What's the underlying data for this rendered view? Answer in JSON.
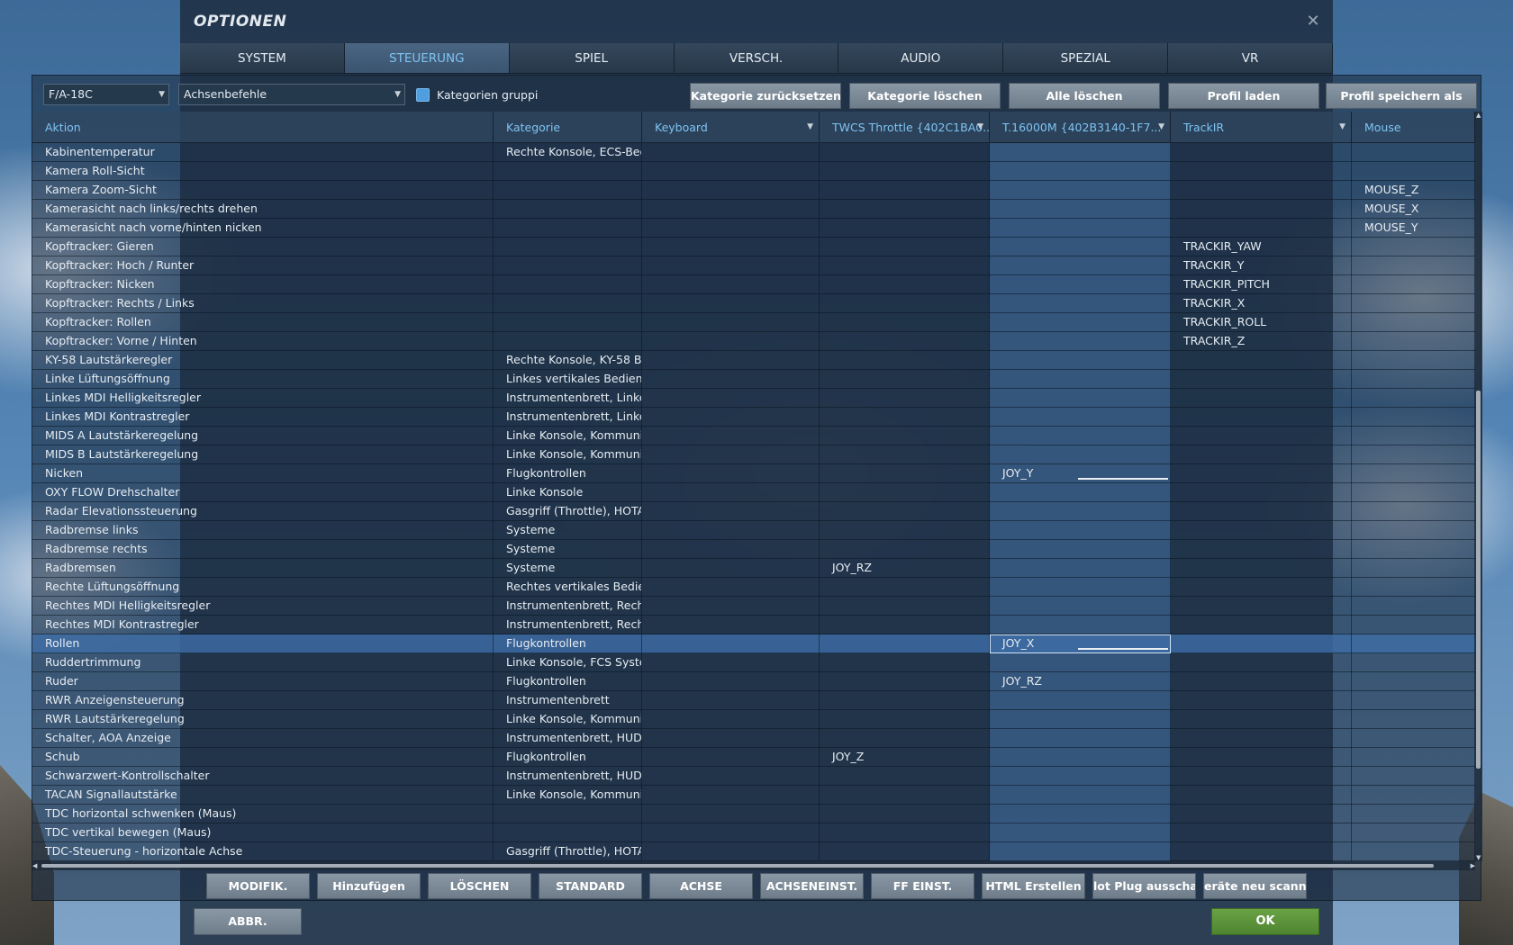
{
  "dialog": {
    "title": "OPTIONEN",
    "close_symbol": "✕"
  },
  "tabs": [
    {
      "label": "SYSTEM"
    },
    {
      "label": "STEUERUNG",
      "active": true
    },
    {
      "label": "SPIEL"
    },
    {
      "label": "VERSCH."
    },
    {
      "label": "AUDIO"
    },
    {
      "label": "SPEZIAL"
    },
    {
      "label": "VR"
    }
  ],
  "toolbar": {
    "aircraft_select": "F/A-18C",
    "category_select": "Achsenbefehle",
    "group_checkbox_label": "Kategorien gruppi",
    "group_checkbox_checked": true,
    "buttons": [
      "Kategorie zurücksetzen",
      "Kategorie löschen",
      "Alle löschen",
      "Profil laden",
      "Profil speichern als"
    ]
  },
  "columns": [
    "Aktion",
    "Kategorie",
    "Keyboard",
    "TWCS Throttle {402C1BA0...",
    "T.16000M {402B3140-1F7...",
    "TrackIR",
    "Mouse"
  ],
  "rows": [
    [
      "Kabinentemperatur",
      "Rechte Konsole, ECS-Bedi",
      "",
      "",
      "",
      "",
      ""
    ],
    [
      "Kamera Roll-Sicht",
      "",
      "",
      "",
      "",
      "",
      ""
    ],
    [
      "Kamera Zoom-Sicht",
      "",
      "",
      "",
      "",
      "",
      "MOUSE_Z"
    ],
    [
      "Kamerasicht nach links/rechts drehen",
      "",
      "",
      "",
      "",
      "",
      "MOUSE_X"
    ],
    [
      "Kamerasicht nach vorne/hinten nicken",
      "",
      "",
      "",
      "",
      "",
      "MOUSE_Y"
    ],
    [
      "Kopftracker: Gieren",
      "",
      "",
      "",
      "",
      "TRACKIR_YAW",
      ""
    ],
    [
      "Kopftracker: Hoch / Runter",
      "",
      "",
      "",
      "",
      "TRACKIR_Y",
      ""
    ],
    [
      "Kopftracker: Nicken",
      "",
      "",
      "",
      "",
      "TRACKIR_PITCH",
      ""
    ],
    [
      "Kopftracker: Rechts / Links",
      "",
      "",
      "",
      "",
      "TRACKIR_X",
      ""
    ],
    [
      "Kopftracker: Rollen",
      "",
      "",
      "",
      "",
      "TRACKIR_ROLL",
      ""
    ],
    [
      "Kopftracker: Vorne / Hinten",
      "",
      "",
      "",
      "",
      "TRACKIR_Z",
      ""
    ],
    [
      "KY-58 Lautstärkeregler",
      "Rechte Konsole, KY-58 Bec",
      "",
      "",
      "",
      "",
      ""
    ],
    [
      "Linke Lüftungsöffnung",
      "Linkes vertikales Bedienfe",
      "",
      "",
      "",
      "",
      ""
    ],
    [
      "Linkes MDI Helligkeitsregler",
      "Instrumentenbrett, Linkes",
      "",
      "",
      "",
      "",
      ""
    ],
    [
      "Linkes MDI Kontrastregler",
      "Instrumentenbrett, Linkes",
      "",
      "",
      "",
      "",
      ""
    ],
    [
      "MIDS A Lautstärkeregelung",
      "Linke Konsole, Kommunik",
      "",
      "",
      "",
      "",
      ""
    ],
    [
      "MIDS B Lautstärkeregelung",
      "Linke Konsole, Kommunik",
      "",
      "",
      "",
      "",
      ""
    ],
    [
      "Nicken",
      "Flugkontrollen",
      "",
      "",
      "JOY_Y",
      "",
      ""
    ],
    [
      "OXY FLOW Drehschalter",
      "Linke Konsole",
      "",
      "",
      "",
      "",
      ""
    ],
    [
      "Radar Elevationssteuerung",
      "Gasgriff (Throttle), HOTAS",
      "",
      "",
      "",
      "",
      ""
    ],
    [
      "Radbremse links",
      "Systeme",
      "",
      "",
      "",
      "",
      ""
    ],
    [
      "Radbremse rechts",
      "Systeme",
      "",
      "",
      "",
      "",
      ""
    ],
    [
      "Radbremsen",
      "Systeme",
      "",
      "JOY_RZ",
      "",
      "",
      ""
    ],
    [
      "Rechte Lüftungsöffnung",
      "Rechtes vertikales Bedien",
      "",
      "",
      "",
      "",
      ""
    ],
    [
      "Rechtes MDI Helligkeitsregler",
      "Instrumentenbrett, Rechte",
      "",
      "",
      "",
      "",
      ""
    ],
    [
      "Rechtes MDI Kontrastregler",
      "Instrumentenbrett, Rechte",
      "",
      "",
      "",
      "",
      ""
    ],
    [
      "Rollen",
      "Flugkontrollen",
      "",
      "",
      "JOY_X",
      "",
      ""
    ],
    [
      "Ruddertrimmung",
      "Linke Konsole, FCS Syster",
      "",
      "",
      "",
      "",
      ""
    ],
    [
      "Ruder",
      "Flugkontrollen",
      "",
      "",
      "JOY_RZ",
      "",
      ""
    ],
    [
      "RWR Anzeigensteuerung",
      "Instrumentenbrett",
      "",
      "",
      "",
      "",
      ""
    ],
    [
      "RWR Lautstärkeregelung",
      "Linke Konsole, Kommunik",
      "",
      "",
      "",
      "",
      ""
    ],
    [
      "Schalter, AOA Anzeige",
      "Instrumentenbrett, HUD E",
      "",
      "",
      "",
      "",
      ""
    ],
    [
      "Schub",
      "Flugkontrollen",
      "",
      "JOY_Z",
      "",
      "",
      ""
    ],
    [
      "Schwarzwert-Kontrollschalter",
      "Instrumentenbrett, HUD E",
      "",
      "",
      "",
      "",
      ""
    ],
    [
      "TACAN Signallautstärke",
      "Linke Konsole, Kommunik",
      "",
      "",
      "",
      "",
      ""
    ],
    [
      "TDC horizontal schwenken (Maus)",
      "",
      "",
      "",
      "",
      "",
      ""
    ],
    [
      "TDC vertikal bewegen (Maus)",
      "",
      "",
      "",
      "",
      "",
      ""
    ],
    [
      "TDC-Steuerung - horizontale Achse",
      "Gasgriff (Throttle), HOTAS",
      "",
      "",
      "",
      "",
      ""
    ]
  ],
  "selected_row_index": 26,
  "bottom_buttons": [
    "MODIFIK.",
    "Hinzufügen",
    "LÖSCHEN",
    "STANDARD",
    "ACHSE",
    "ACHSENEINST.",
    "FF EINST.",
    "HTML Erstellen",
    "lot Plug ausschalte",
    "eräte neu scanne"
  ],
  "footer": {
    "cancel_label": "ABBR.",
    "ok_label": "OK"
  },
  "colors": {
    "accent_text": "#7fc3f2",
    "ok_green": "#5a9438",
    "selection": "#3e6ea8"
  }
}
